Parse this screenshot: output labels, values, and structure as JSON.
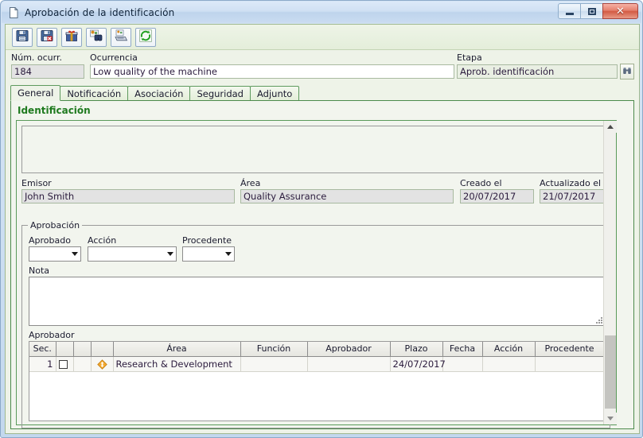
{
  "window": {
    "title": "Aprobación de la identificación",
    "title_icon": "document-icon",
    "controls": {
      "minimize": "minimize-button",
      "maximize": "maximize-button",
      "close": "close-button",
      "close_glyph": "✕"
    }
  },
  "toolbar": {
    "buttons": [
      {
        "name": "save-button",
        "icon": "floppy-save-icon",
        "tooltip": "Guardar"
      },
      {
        "name": "save-close-button",
        "icon": "floppy-delete-icon",
        "tooltip": "Guardar y cerrar"
      },
      {
        "name": "attachment-button",
        "icon": "gift-box-icon",
        "tooltip": "Adjuntos"
      },
      {
        "name": "search-button",
        "icon": "binoculars-search-icon",
        "tooltip": "Buscar"
      },
      {
        "name": "print-button",
        "icon": "print-icon",
        "tooltip": "Imprimir"
      },
      {
        "name": "refresh-button",
        "icon": "refresh-icon",
        "tooltip": "Actualizar"
      }
    ]
  },
  "header": {
    "num_occ_label": "Núm. ocurr.",
    "num_occ_value": "184",
    "occurrence_label": "Ocurrencia",
    "occurrence_value": "Low quality of the machine",
    "stage_label": "Etapa",
    "stage_value": "Aprob. identificación",
    "stage_search_icon": "binoculars-icon"
  },
  "tabs": [
    {
      "label": "General",
      "active": true
    },
    {
      "label": "Notificación",
      "active": false
    },
    {
      "label": "Asociación",
      "active": false
    },
    {
      "label": "Seguridad",
      "active": false
    },
    {
      "label": "Adjunto",
      "active": false
    }
  ],
  "identification": {
    "section_title": "Identificación",
    "description_value": "",
    "fields": [
      {
        "name": "emisor",
        "label": "Emisor",
        "value": "John Smith"
      },
      {
        "name": "area",
        "label": "Área",
        "value": "Quality Assurance"
      },
      {
        "name": "creado-el",
        "label": "Creado el",
        "value": "20/07/2017"
      },
      {
        "name": "actualizado-el",
        "label": "Actualizado el",
        "value": "21/07/2017"
      }
    ]
  },
  "approval": {
    "legend": "Aprobación",
    "combos": [
      {
        "name": "aprobado",
        "label": "Aprobado",
        "value": ""
      },
      {
        "name": "accion",
        "label": "Acción",
        "value": ""
      },
      {
        "name": "procedente",
        "label": "Procedente",
        "value": ""
      }
    ],
    "note_label": "Nota",
    "note_value": "",
    "approver_label": "Aprobador",
    "grid": {
      "columns": [
        "Sec.",
        "",
        "",
        "",
        "Área",
        "Función",
        "Aprobador",
        "Plazo",
        "Fecha",
        "Acción",
        "Procedente"
      ],
      "rows": [
        {
          "sec": "1",
          "checked": false,
          "row_icon": "orange-diamond-arrow-icon",
          "area": "Research & Development",
          "funcion": "",
          "aprobador": "",
          "plazo": "24/07/2017",
          "fecha": "",
          "accion": "",
          "procedente": ""
        }
      ]
    }
  },
  "scrollbar": {
    "up_arrow": "scroll-up-arrow",
    "down_arrow": "scroll-down-arrow"
  },
  "colors": {
    "accent_green": "#1f7a1f",
    "panel_border": "#4c8a4c",
    "client_bg": "#eef3e8",
    "title_bg": "#cfe0f3",
    "close_red": "#d35b44",
    "row_icon_orange": "#f0a32a"
  }
}
